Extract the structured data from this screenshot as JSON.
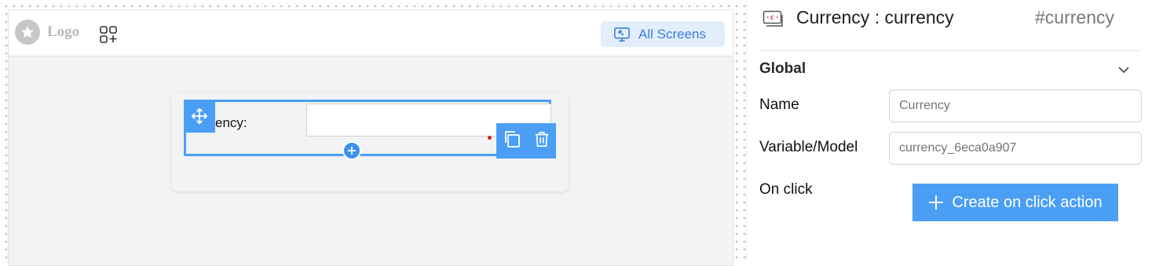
{
  "canvas": {
    "header": {
      "logo_text": "Logo",
      "all_screens_label": "All Screens"
    },
    "component": {
      "label": "ency:",
      "input_value": ""
    }
  },
  "panel": {
    "title": "Currency : currency",
    "id": "#currency",
    "section": "Global",
    "name_label": "Name",
    "name_placeholder": "Currency",
    "variable_label": "Variable/Model",
    "variable_placeholder": "currency_6eca0a907",
    "onclick_label": "On click",
    "create_action_label": "Create on click action"
  },
  "colors": {
    "accent": "#4a9ff5",
    "chip_bg": "#e3eefc",
    "chip_text": "#3a7fd6",
    "canvas_bg": "#f2f3f5"
  },
  "icons": [
    "star-icon",
    "add-widget-icon",
    "screens-icon",
    "move-icon",
    "copy-icon",
    "trash-icon",
    "plus-icon",
    "currency-icon",
    "chevron-down-icon"
  ]
}
